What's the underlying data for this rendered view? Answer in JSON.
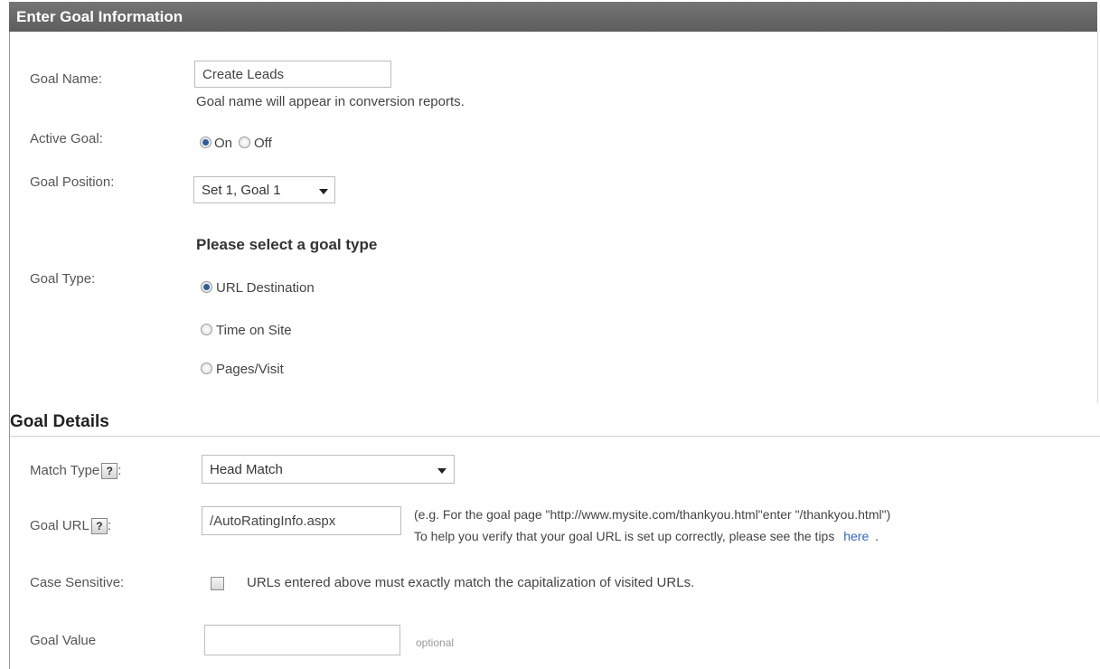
{
  "header": {
    "title": "Enter Goal Information"
  },
  "goal_name": {
    "label": "Goal Name:",
    "value": "Create Leads",
    "hint": "Goal name will appear in conversion reports."
  },
  "active_goal": {
    "label": "Active Goal:",
    "on": "On",
    "off": "Off",
    "selected": "On"
  },
  "goal_position": {
    "label": "Goal Position:",
    "value": "Set 1, Goal 1"
  },
  "goal_type": {
    "heading": "Please select a goal type",
    "label": "Goal Type:",
    "options": [
      "URL Destination",
      "Time on Site",
      "Pages/Visit"
    ],
    "selected": "URL Destination"
  },
  "goal_details": {
    "title": "Goal Details",
    "match_type": {
      "label": "Match Type",
      "suffix": ":",
      "value": "Head Match"
    },
    "goal_url": {
      "label": "Goal URL",
      "suffix": ":",
      "value": "/AutoRatingInfo.aspx",
      "example": "(e.g. For the goal page \"http://www.mysite.com/thankyou.html\"enter \"/thankyou.html\")",
      "tips_prefix": "To help you verify that your goal URL is set up correctly, please see the tips",
      "tips_link": "here",
      "tips_suffix": "."
    },
    "case_sensitive": {
      "label": "Case Sensitive:",
      "description": "URLs entered above must exactly match the capitalization of visited URLs.",
      "checked": false
    },
    "goal_value": {
      "label": "Goal Value",
      "value": "",
      "hint": "optional"
    },
    "help_glyph": "?"
  },
  "colors": {
    "header_bg": "#666666",
    "link": "#3366cc",
    "radio_selected": "#2e5f9c"
  }
}
